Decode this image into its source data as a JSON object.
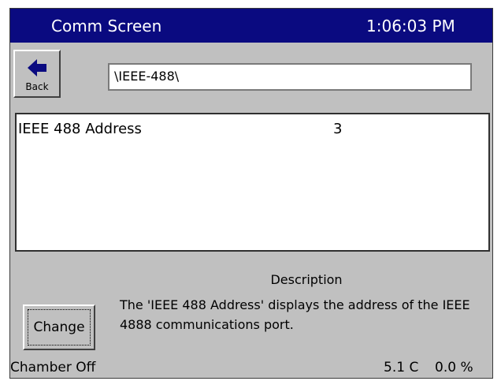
{
  "window": {
    "title": "Comm Screen",
    "clock": "1:06:03 PM",
    "title_bar_color": "#0a0a80"
  },
  "toolbar": {
    "back_label": "Back",
    "back_icon": "left-arrow-icon",
    "path_value": "\\IEEE-488\\"
  },
  "settings_list": {
    "items": [
      {
        "name": "IEEE 488 Address",
        "value": "3"
      }
    ]
  },
  "description": {
    "heading": "Description",
    "text": "The 'IEEE 488 Address' displays the address of the IEEE 4888 communications port."
  },
  "actions": {
    "change_label": "Change"
  },
  "status_bar": {
    "chamber_state": "Chamber Off",
    "temperature": "5.1 C",
    "percent": "0.0 %"
  }
}
